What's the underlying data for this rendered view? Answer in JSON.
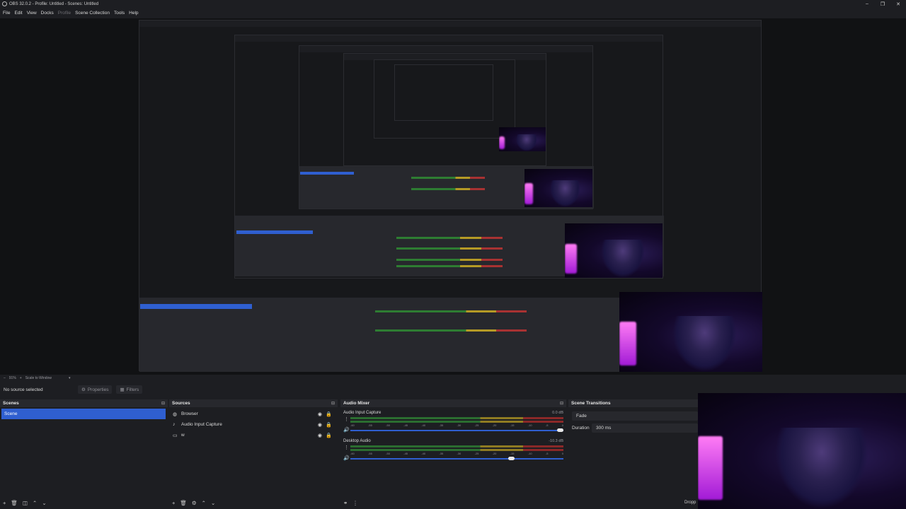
{
  "window": {
    "title": "OBS 32.0.2 - Profile: Untitled - Scenes: Untitled",
    "controls": [
      "–",
      "❐",
      "✕"
    ]
  },
  "menu": [
    "File",
    "Edit",
    "View",
    "Docks",
    "Profile",
    "Scene Collection",
    "Tools",
    "Help"
  ],
  "preview_controls": {
    "zoom": "91%",
    "scale_mode": "Scale to Window"
  },
  "context_bar": {
    "no_source": "No source selected",
    "properties": "Properties",
    "filters": "Filters"
  },
  "scenes": {
    "title": "Scenes",
    "items": [
      "Scene"
    ]
  },
  "sources": {
    "title": "Sources",
    "items": [
      {
        "name": "Browser",
        "icon": "globe-icon"
      },
      {
        "name": "Audio Input Capture",
        "icon": "microphone-icon"
      },
      {
        "name": "w",
        "icon": "monitor-icon"
      }
    ]
  },
  "mixer": {
    "title": "Audio Mixer",
    "channels": [
      {
        "name": "Audio Input Capture",
        "db": "0.0 dB",
        "fader_level": 1.0
      },
      {
        "name": "Desktop Audio",
        "db": "-10.3 dB",
        "fader_level": 0.77
      }
    ],
    "ticks": [
      "-60",
      "-55",
      "-50",
      "-45",
      "-40",
      "-35",
      "-30",
      "-25",
      "-20",
      "-15",
      "-10",
      "-5",
      "0"
    ]
  },
  "transitions": {
    "title": "Scene Transitions",
    "type": "Fade",
    "duration_label": "Duration",
    "duration_value": "300 ms"
  },
  "dropdown_hint": "Dropp",
  "colors": {
    "accent": "#2f5fd0",
    "panel": "#27282d",
    "background": "#1d1e22",
    "cam_glow": "#e25cf2"
  }
}
